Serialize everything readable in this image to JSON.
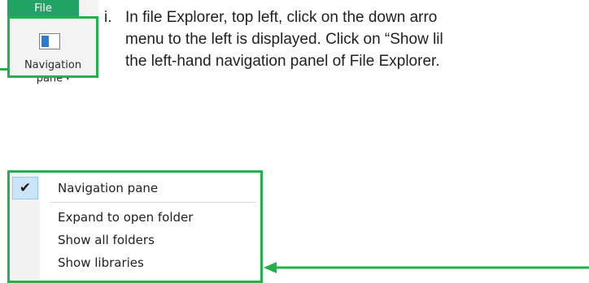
{
  "ribbon": {
    "file_tab": "File",
    "nav_pane_label_line1": "Navigation",
    "nav_pane_label_line2": "pane",
    "nav_pane_caret": "▾"
  },
  "instruction": {
    "number": "i.",
    "line1": "In file Explorer, top left, click on the down arro",
    "line2": "menu to the left is displayed. Click on “Show lil",
    "line3": "the left-hand navigation panel of File Explorer."
  },
  "menu": {
    "items": [
      {
        "label": "Navigation pane",
        "checked": true
      },
      {
        "label": "Expand to open folder",
        "checked": false
      },
      {
        "label": "Show all folders",
        "checked": false
      },
      {
        "label": "Show libraries",
        "checked": false
      }
    ],
    "check_glyph": "✔"
  },
  "colors": {
    "highlight": "#22b14c",
    "file_tab": "#21a366",
    "check_bg": "#cce4f7",
    "icon_blue": "#2b7bd5"
  }
}
